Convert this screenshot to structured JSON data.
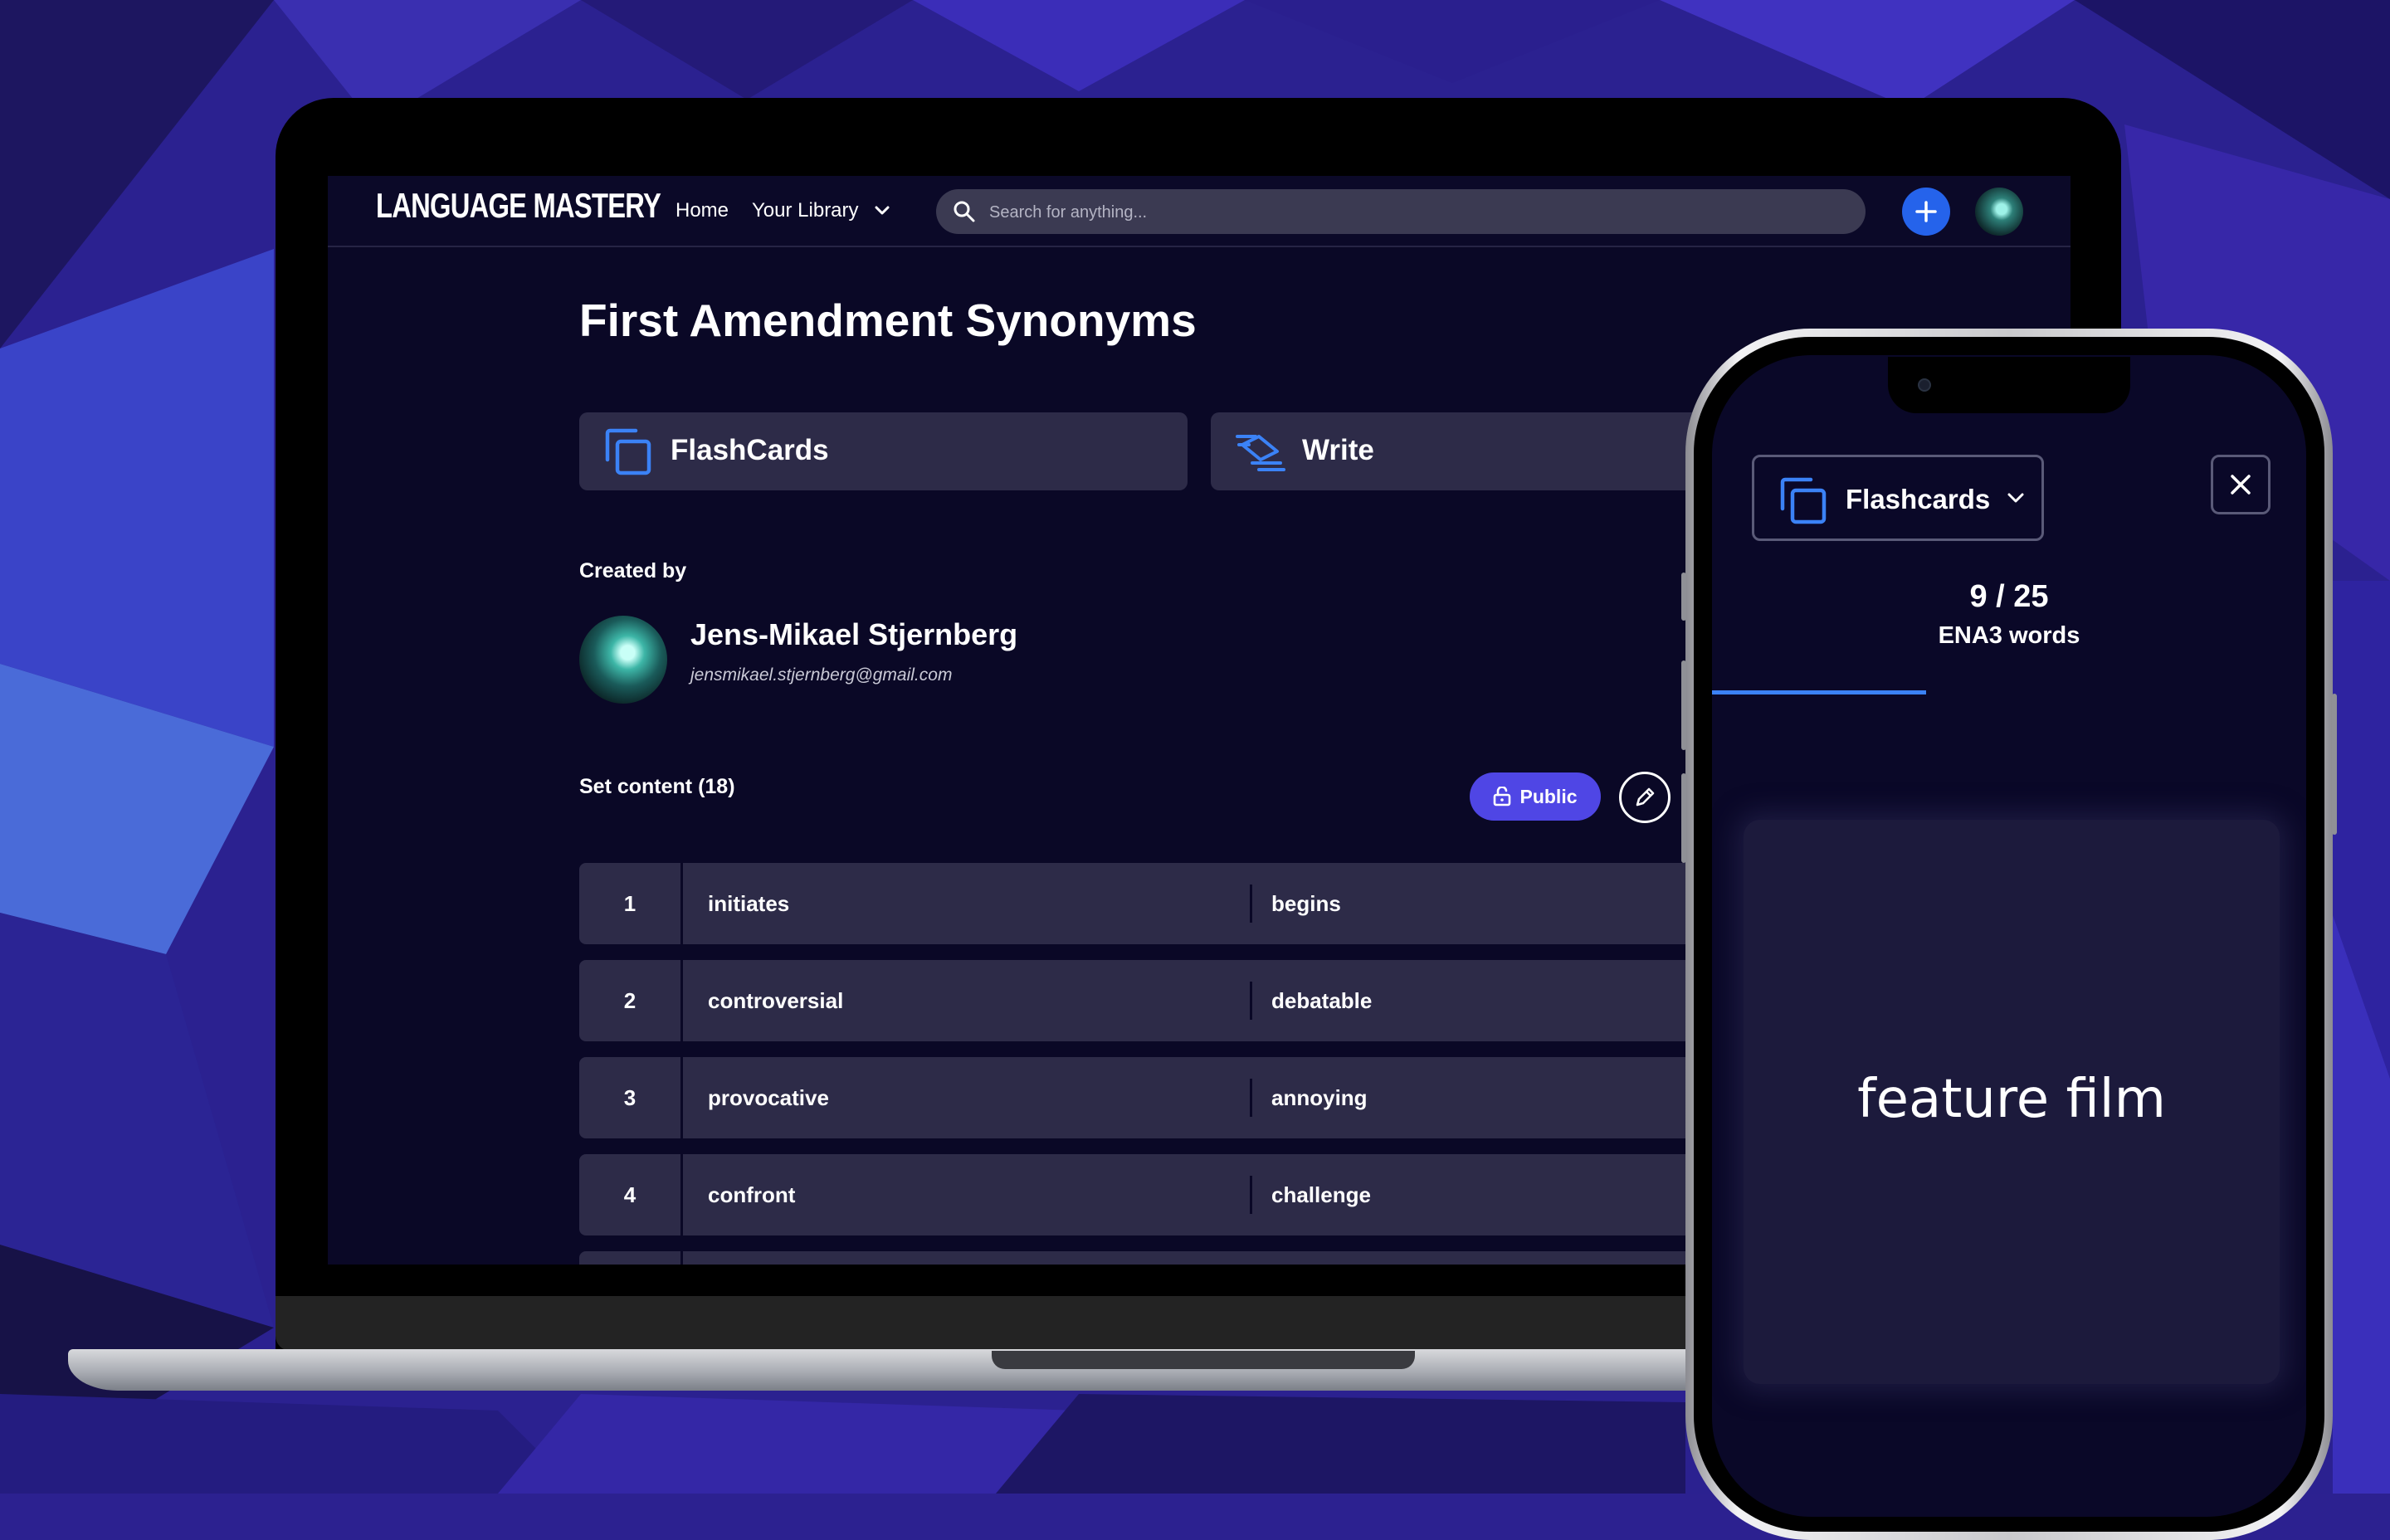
{
  "colors": {
    "background": "#2c2190",
    "screen_bg": "#0a0826",
    "card_bg": "#2d2b48",
    "accent_blue": "#2563eb",
    "accent_indigo": "#4f46e5"
  },
  "laptop": {
    "nav": {
      "logo": "LANGUAGE MASTERY",
      "home": "Home",
      "library": "Your Library",
      "search_placeholder": "Search for anything..."
    },
    "set": {
      "title": "First Amendment Synonyms",
      "modes": [
        {
          "label": "FlashCards",
          "icon": "cards-icon"
        },
        {
          "label": "Write",
          "icon": "write-icon"
        }
      ],
      "created_by_label": "Created by",
      "creator": {
        "name": "Jens-Mikael Stjernberg",
        "email": "jensmikael.stjernberg@gmail.com"
      },
      "content_label": "Set content (18)",
      "visibility": "Public",
      "rows": [
        {
          "num": "1",
          "term": "initiates",
          "definition": "begins"
        },
        {
          "num": "2",
          "term": "controversial",
          "definition": "debatable"
        },
        {
          "num": "3",
          "term": "provocative",
          "definition": "annoying"
        },
        {
          "num": "4",
          "term": "confront",
          "definition": "challenge"
        }
      ]
    }
  },
  "phone": {
    "mode_select": "Flashcards",
    "counter": "9 / 25",
    "set_name": "ENA3 words",
    "progress": 0.36,
    "card_text": "feature film"
  }
}
